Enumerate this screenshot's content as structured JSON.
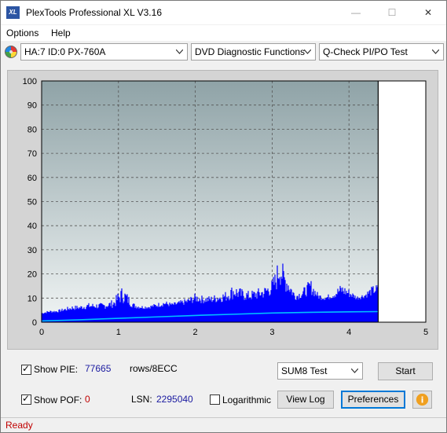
{
  "window": {
    "title": "PlexTools Professional XL V3.16",
    "app_icon_text": "XL",
    "minimize": "—",
    "maximize": "☐",
    "close": "✕"
  },
  "menu": {
    "items": [
      {
        "label": "Options"
      },
      {
        "label": "Help"
      }
    ]
  },
  "toolbar": {
    "drive": "HA:7 ID:0  PX-760A",
    "function": "DVD Diagnostic Functions",
    "test": "Q-Check PI/PO Test"
  },
  "chart_data": {
    "type": "bar",
    "x_ticks": [
      "0",
      "1",
      "2",
      "3",
      "4",
      "5"
    ],
    "y_ticks": [
      "0",
      "10",
      "20",
      "30",
      "40",
      "50",
      "60",
      "70",
      "80",
      "90",
      "100"
    ],
    "xlim": [
      0,
      5
    ],
    "ylim": [
      0,
      100
    ],
    "grid": true,
    "end_marker_x": 4.38,
    "colors": {
      "pie": "#0000ff",
      "cumulative": "#00c0ff",
      "bg_top": "#8fa3a7",
      "bg_bottom": "#f0f4f4"
    },
    "series": [
      {
        "type": "pie_envelope",
        "x": [
          0.0,
          0.1,
          0.2,
          0.3,
          0.4,
          0.5,
          0.6,
          0.7,
          0.8,
          0.9,
          0.95,
          1.0,
          1.05,
          1.1,
          1.2,
          1.3,
          1.4,
          1.5,
          1.6,
          1.7,
          1.8,
          1.9,
          2.0,
          2.1,
          2.2,
          2.3,
          2.4,
          2.5,
          2.6,
          2.7,
          2.8,
          2.9,
          3.0,
          3.05,
          3.1,
          3.15,
          3.2,
          3.3,
          3.4,
          3.5,
          3.6,
          3.7,
          3.8,
          3.9,
          4.0,
          4.1,
          4.2,
          4.3,
          4.38
        ],
        "values": [
          4,
          5,
          5,
          6,
          7,
          7,
          8,
          8,
          8,
          9,
          10,
          13,
          15,
          13,
          8,
          7,
          7,
          8,
          9,
          8,
          9,
          10,
          12,
          11,
          11,
          12,
          13,
          16,
          14,
          13,
          14,
          15,
          18,
          22,
          30,
          23,
          20,
          12,
          14,
          18,
          12,
          11,
          13,
          16,
          14,
          11,
          12,
          15,
          16
        ]
      },
      {
        "type": "pie_base",
        "x": [
          0.0,
          0.5,
          1.0,
          1.5,
          2.0,
          2.5,
          3.0,
          3.5,
          4.0,
          4.38
        ],
        "values": [
          3,
          4,
          4,
          5,
          6,
          6,
          7,
          8,
          8,
          9
        ]
      },
      {
        "type": "cumulative",
        "x": [
          0.0,
          0.5,
          1.0,
          1.5,
          2.0,
          2.5,
          3.0,
          3.5,
          4.0,
          4.38
        ],
        "values": [
          0.5,
          1.0,
          1.6,
          2.2,
          2.8,
          3.3,
          3.8,
          4.1,
          4.3,
          4.4
        ]
      }
    ]
  },
  "bottom": {
    "show_pie_label": "Show PIE:",
    "pie_value": "77665",
    "pie_unit": "rows/8ECC",
    "show_pof_label": "Show POF:",
    "pof_value": "0",
    "lsn_label": "LSN:",
    "lsn_value": "2295040",
    "logarithmic_label": "Logarithmic",
    "sum_select": "SUM8 Test",
    "start_label": "Start",
    "view_log_label": "View Log",
    "preferences_label": "Preferences",
    "info_icon": "i"
  },
  "status": {
    "text": "Ready"
  }
}
